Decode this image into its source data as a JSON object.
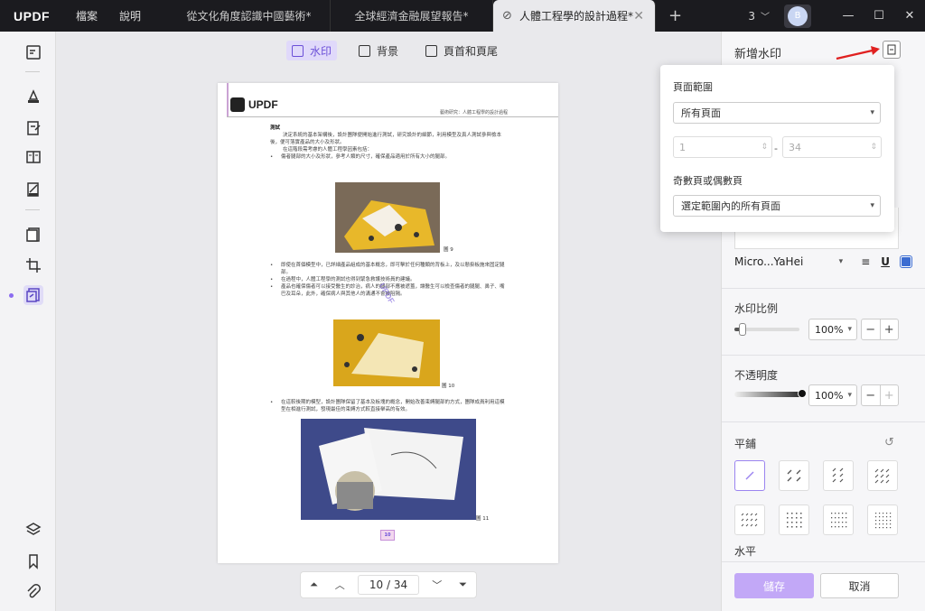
{
  "app": {
    "logo": "UPDF"
  },
  "menu": [
    {
      "label": "檔案"
    },
    {
      "label": "說明"
    }
  ],
  "tabs": [
    {
      "label": "從文化角度認識中國藝術*"
    },
    {
      "label": "全球經濟金融展望報告*"
    },
    {
      "label": "人體工程學的設計過程*"
    }
  ],
  "titlebar": {
    "tab_count": "3",
    "avatar_initial": "B"
  },
  "watermark_tabs": [
    {
      "label": "水印"
    },
    {
      "label": "背景"
    },
    {
      "label": "頁首和頁尾"
    }
  ],
  "document": {
    "header_text": "藝術研究：人體工程學的設計過程",
    "logo_text": "UPDF",
    "heading": "測試",
    "para1": "決定系統的基本架構後，設計團隊便開始進行測試，研究設計的細節，利用模型及真人測試參與檢本後，便可落實產品的大小及形狀。",
    "para2": "在這階段需考慮的人體工程學因素包括：",
    "bullet1": "傷者腿部的大小及形狀，參考人類的尺寸，確保產品適用於所有大小的腿部。",
    "fig9": "圖 9",
    "bullet2": "即使在首個模型中，已詳細產品組成的基本概念，即可擊於任何種類的背板上，及以懸掛板施來固定腿部。",
    "bullet3": "在過程中，人體工程學的測試也得到緊急救護技術員的建議。",
    "bullet4": "產品也確保傷者可以接受醫生的診治，病人的腿部不應被遮蓋，讓醫生可以檢查傷者的腿腿、鼻子、嘴巴及耳朵，此外，確保病人與其他人的溝通不會被阻隔。",
    "fig10": "圖 10",
    "bullet5": "在這較後期的模型，設計團隊保留了基本及板塊的概念，開始改善束縛腿部的方式，團隊成員利用這模型在相進行測試，發現最佳的束縛方式較直接舉高的有效。",
    "fig11": "圖 11",
    "page_badge": "10",
    "stamp_text": "UPDF"
  },
  "pager": {
    "current": "10",
    "separator": "/",
    "total": "34"
  },
  "panel": {
    "title": "新增水印",
    "font_name": "Micro...YaHei",
    "font_color": "#3b6cd1",
    "scale_label": "水印比例",
    "scale_value": "100%",
    "scale_fraction": 0.12,
    "opacity_label": "不透明度",
    "opacity_value": "100%",
    "tile_label": "平鋪",
    "horizontal_label": "水平",
    "save": "儲存",
    "cancel": "取消",
    "accent_color": "#c2a8f7"
  },
  "popover": {
    "range_label": "頁面範圍",
    "range_value": "所有頁面",
    "from_placeholder": "1",
    "to_placeholder": "34",
    "dash": "-",
    "parity_label": "奇數頁或偶數頁",
    "parity_value": "選定範圍內的所有頁面"
  }
}
